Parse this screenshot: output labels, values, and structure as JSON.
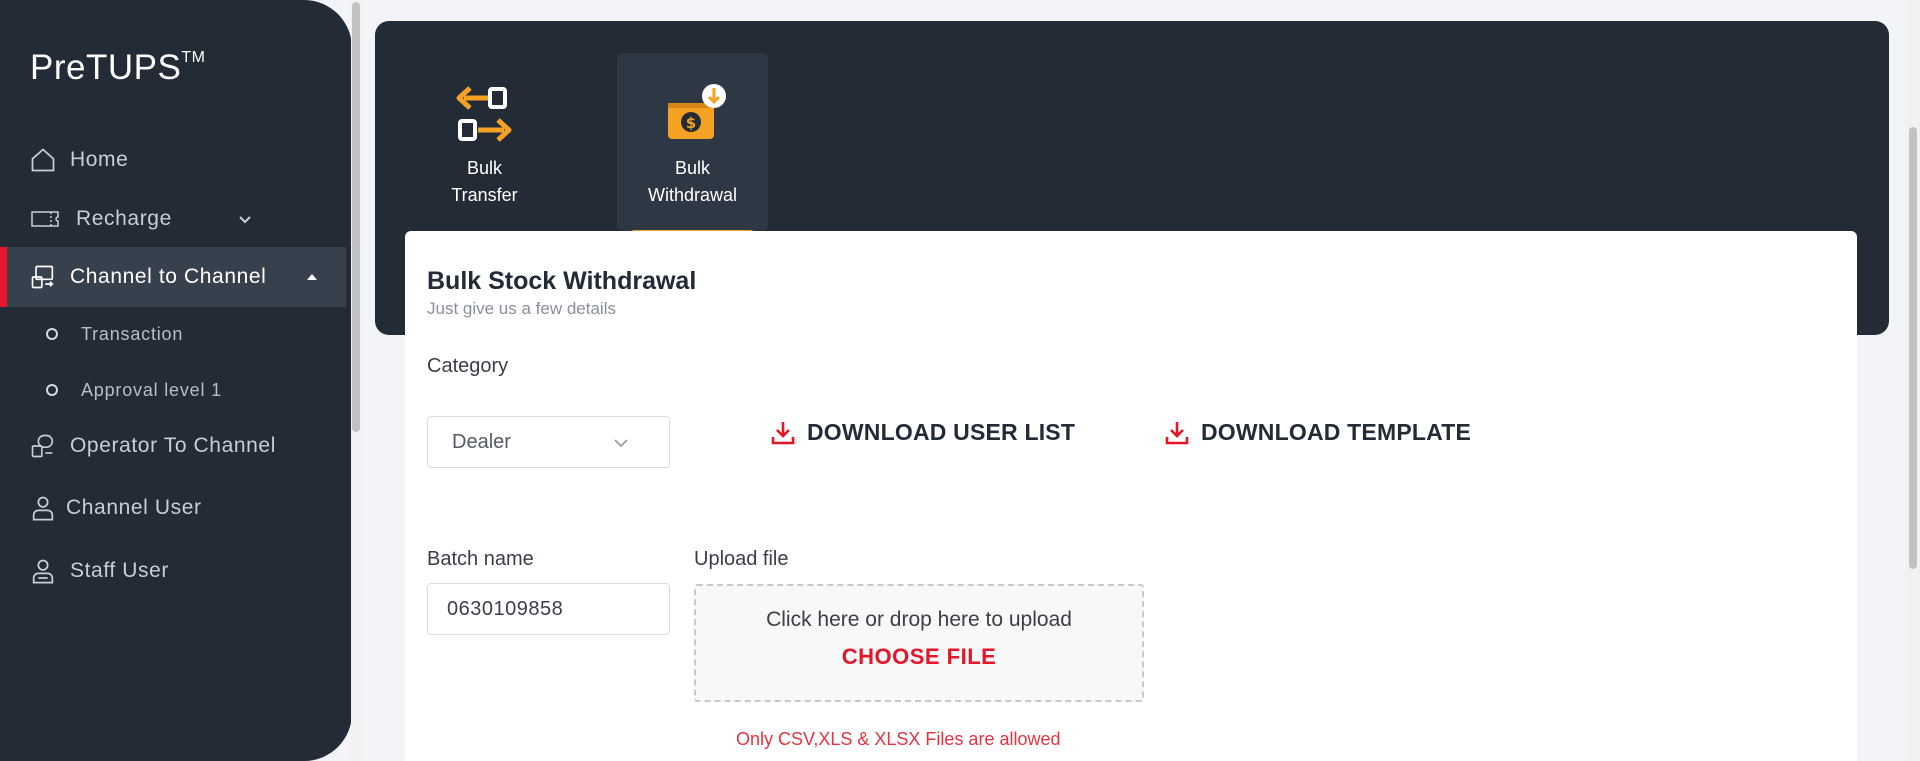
{
  "brand": {
    "name": "PreTUPS",
    "tm": "TM"
  },
  "sidebar": {
    "items": [
      {
        "label": "Home",
        "icon": "home-icon"
      },
      {
        "label": "Recharge",
        "icon": "ticket-icon"
      },
      {
        "label": "Channel to Channel",
        "icon": "channel-icon",
        "active": true
      },
      {
        "label": "Operator To Channel",
        "icon": "operator-icon"
      },
      {
        "label": "Channel User",
        "icon": "user-icon"
      },
      {
        "label": "Staff User",
        "icon": "staff-icon"
      }
    ],
    "subitems": [
      {
        "label": "Transaction"
      },
      {
        "label": "Approval level 1"
      }
    ]
  },
  "tiles": [
    {
      "line1": "Bulk",
      "line2": "Transfer",
      "icon": "transfer-arrows-icon"
    },
    {
      "line1": "Bulk",
      "line2": "Withdrawal",
      "icon": "withdrawal-wallet-icon",
      "active": true
    }
  ],
  "form": {
    "title": "Bulk Stock Withdrawal",
    "subtitle": "Just give us a few details",
    "category_label": "Category",
    "category_value": "Dealer",
    "download_user_list": "DOWNLOAD USER LIST",
    "download_template": "DOWNLOAD TEMPLATE",
    "batch_label": "Batch name",
    "batch_value": "0630109858",
    "upload_label": "Upload file",
    "upload_hint": "Click here or drop here to upload",
    "choose_file": "CHOOSE FILE",
    "file_note": "Only CSV,XLS & XLSX Files are allowed"
  },
  "colors": {
    "sidebar_bg": "#222b36",
    "accent_red": "#e5152a",
    "accent_orange": "#f5a123"
  }
}
